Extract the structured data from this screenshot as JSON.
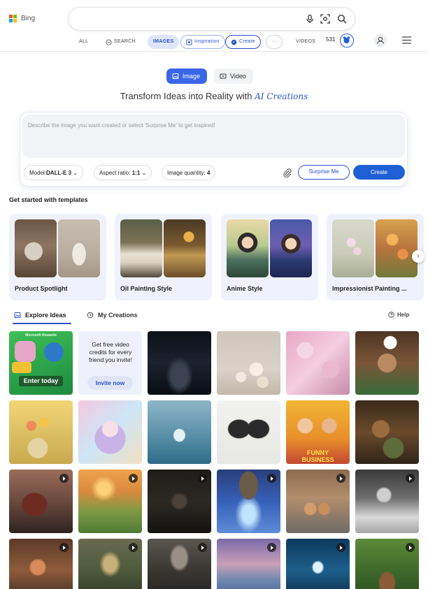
{
  "header": {
    "logo_text": "Bing",
    "nav": {
      "all": "ALL",
      "search": "SEARCH",
      "images": "IMAGES",
      "inspiration": "Inspiration",
      "create": "Create",
      "more": "···",
      "videos": "VIDEOS"
    },
    "rewards_count": "531"
  },
  "creator": {
    "tabs": {
      "image": "Image",
      "video": "Video"
    },
    "tagline": "Transform Ideas into Reality with",
    "tagline_brand": "AI Creations",
    "prompt_placeholder": "Describe the image you want created or select 'Surprise Me' to get inspired!",
    "options": {
      "model_label": "Model:",
      "model_value": "DALL-E 3",
      "aspect_label": "Aspect ratio:",
      "aspect_value": "1:1",
      "quantity_label": "Image quantity:",
      "quantity_value": "4"
    },
    "surprise_label": "Surprise Me",
    "create_label": "Create"
  },
  "templates": {
    "title": "Get started with templates",
    "items": [
      {
        "label": "Product Spotlight"
      },
      {
        "label": "Oil Painting Style"
      },
      {
        "label": "Anime Style"
      },
      {
        "label": "Impressionist Painting ..."
      }
    ]
  },
  "explore": {
    "tab_explore": "Explore Ideas",
    "tab_creations": "My Creations",
    "help": "Help",
    "reward_tile": {
      "brand": "Microsoft Rewards",
      "cta": "Enter today"
    },
    "invite_tile": {
      "text": "Get free video credits for every friend you invite!",
      "cta": "Invite now"
    },
    "poster_text": {
      "line1": "FUNNY",
      "line2": "BUSINESS"
    }
  },
  "colors": {
    "accent": "#1f5fd6",
    "accent_light": "#dfe6fb",
    "template_bg": "#eff2fc"
  }
}
